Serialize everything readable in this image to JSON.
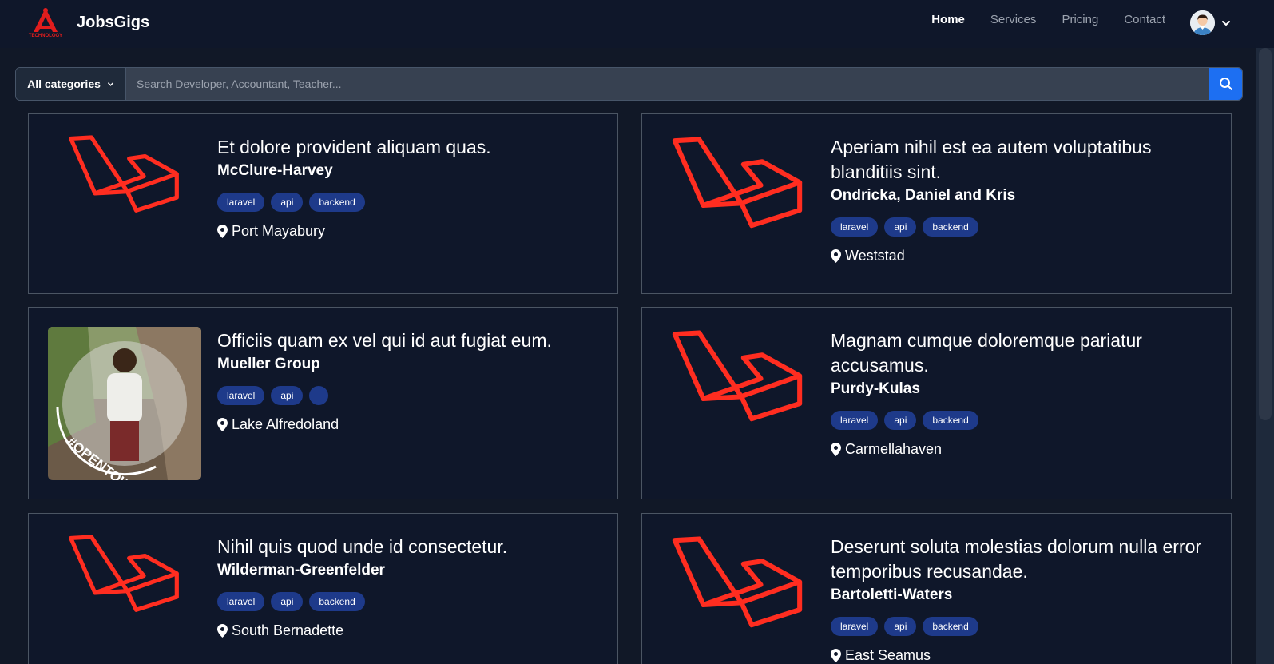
{
  "brand": {
    "name": "JobsGigs",
    "logo_text": "TECHNOLOGY"
  },
  "nav": {
    "items": [
      {
        "label": "Home",
        "active": true
      },
      {
        "label": "Services",
        "active": false
      },
      {
        "label": "Pricing",
        "active": false
      },
      {
        "label": "Contact",
        "active": false
      }
    ]
  },
  "search": {
    "category_label": "All categories",
    "placeholder": "Search Developer, Accountant, Teacher..."
  },
  "colors": {
    "background": "#111827",
    "navbar": "#0f172a",
    "accent_blue": "#1d6ff2",
    "tag_blue": "#1e3a8a",
    "laravel_red": "#ff2d20"
  },
  "listings": [
    {
      "title": "Et dolore provident aliquam quas.",
      "company": "McClure-Harvey",
      "tags": [
        "laravel",
        "api",
        "backend"
      ],
      "location": "Port Mayabury",
      "image": "laravel-logo"
    },
    {
      "title": "Aperiam nihil est ea autem voluptatibus blanditiis sint.",
      "company": "Ondricka, Daniel and Kris",
      "tags": [
        "laravel",
        "api",
        "backend"
      ],
      "location": "Weststad",
      "image": "laravel-logo"
    },
    {
      "title": "Officiis quam ex vel qui id aut fugiat eum.",
      "company": "Mueller Group",
      "tags": [
        "laravel",
        "api",
        ""
      ],
      "location": "Lake Alfredoland",
      "image": "profile-photo",
      "photo_badge": "#OPENTOWORK"
    },
    {
      "title": "Magnam cumque doloremque pariatur accusamus.",
      "company": "Purdy-Kulas",
      "tags": [
        "laravel",
        "api",
        "backend"
      ],
      "location": "Carmellahaven",
      "image": "laravel-logo"
    },
    {
      "title": "Nihil quis quod unde id consectetur.",
      "company": "Wilderman-Greenfelder",
      "tags": [
        "laravel",
        "api",
        "backend"
      ],
      "location": "South Bernadette",
      "image": "laravel-logo"
    },
    {
      "title": "Deserunt soluta molestias dolorum nulla error temporibus recusandae.",
      "company": "Bartoletti-Waters",
      "tags": [
        "laravel",
        "api",
        "backend"
      ],
      "location": "East Seamus",
      "image": "laravel-logo"
    }
  ]
}
